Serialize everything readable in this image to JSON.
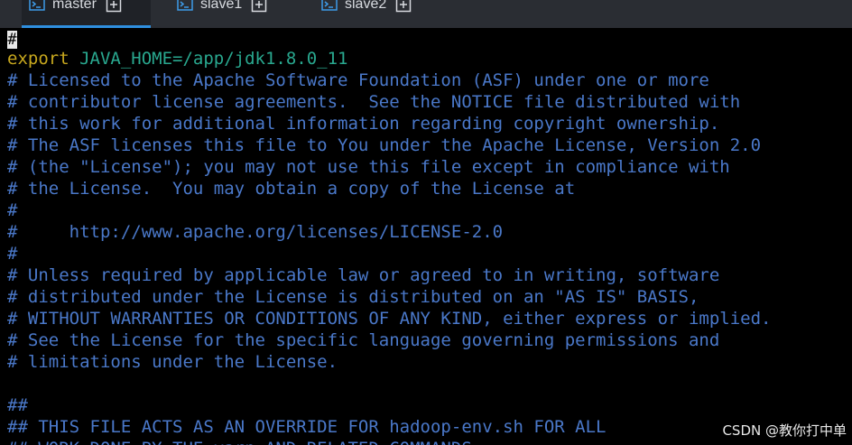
{
  "tabs": [
    {
      "label": "master",
      "active": true
    },
    {
      "label": "slave1",
      "active": false
    },
    {
      "label": "slave2",
      "active": false
    }
  ],
  "terminal": {
    "cursor_char": "#",
    "export_keyword": "export",
    "export_value": " JAVA_HOME=/app/jdk1.8.0_11",
    "lines": [
      "# Licensed to the Apache Software Foundation (ASF) under one or more",
      "# contributor license agreements.  See the NOTICE file distributed with",
      "# this work for additional information regarding copyright ownership.",
      "# The ASF licenses this file to You under the Apache License, Version 2.0",
      "# (the \"License\"); you may not use this file except in compliance with",
      "# the License.  You may obtain a copy of the License at",
      "#",
      "#     http://www.apache.org/licenses/LICENSE-2.0",
      "#",
      "# Unless required by applicable law or agreed to in writing, software",
      "# distributed under the License is distributed on an \"AS IS\" BASIS,",
      "# WITHOUT WARRANTIES OR CONDITIONS OF ANY KIND, either express or implied.",
      "# See the License for the specific language governing permissions and",
      "# limitations under the License.",
      "",
      "##",
      "## THIS FILE ACTS AS AN OVERRIDE FOR hadoop-env.sh FOR ALL",
      "## WORK DONE BY THE yarn AND RELATED COMMANDS."
    ]
  },
  "watermark": "CSDN @教你打中单",
  "colors": {
    "comment": "#4a78c9",
    "export_keyword": "#c8a81e",
    "export_value": "#29a88f",
    "tab_active_underline": "#2f8fdf",
    "background": "#000000"
  }
}
